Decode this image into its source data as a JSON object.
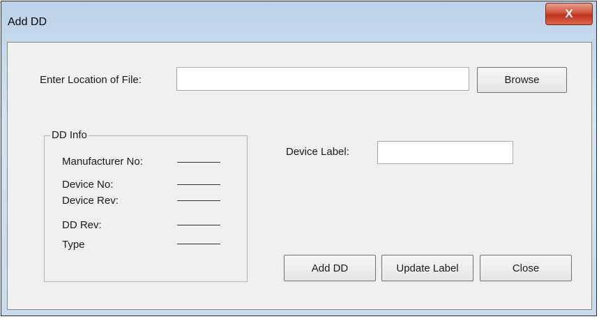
{
  "window": {
    "title": "Add DD",
    "close_glyph": "X"
  },
  "file_row": {
    "label": "Enter Location of File:",
    "value": "",
    "browse_label": "Browse"
  },
  "dd_info": {
    "title": "DD Info",
    "fields": [
      {
        "label": "Manufacturer No:",
        "value": "———"
      },
      {
        "label": "Device No:",
        "value": "———"
      },
      {
        "label": "Device Rev:",
        "value": "———"
      },
      {
        "label": "DD Rev:",
        "value": "———"
      },
      {
        "label": "Type",
        "value": "———"
      }
    ]
  },
  "device_label": {
    "label": "Device Label:",
    "value": ""
  },
  "buttons": {
    "add": "Add DD",
    "update": "Update Label",
    "close": "Close"
  }
}
